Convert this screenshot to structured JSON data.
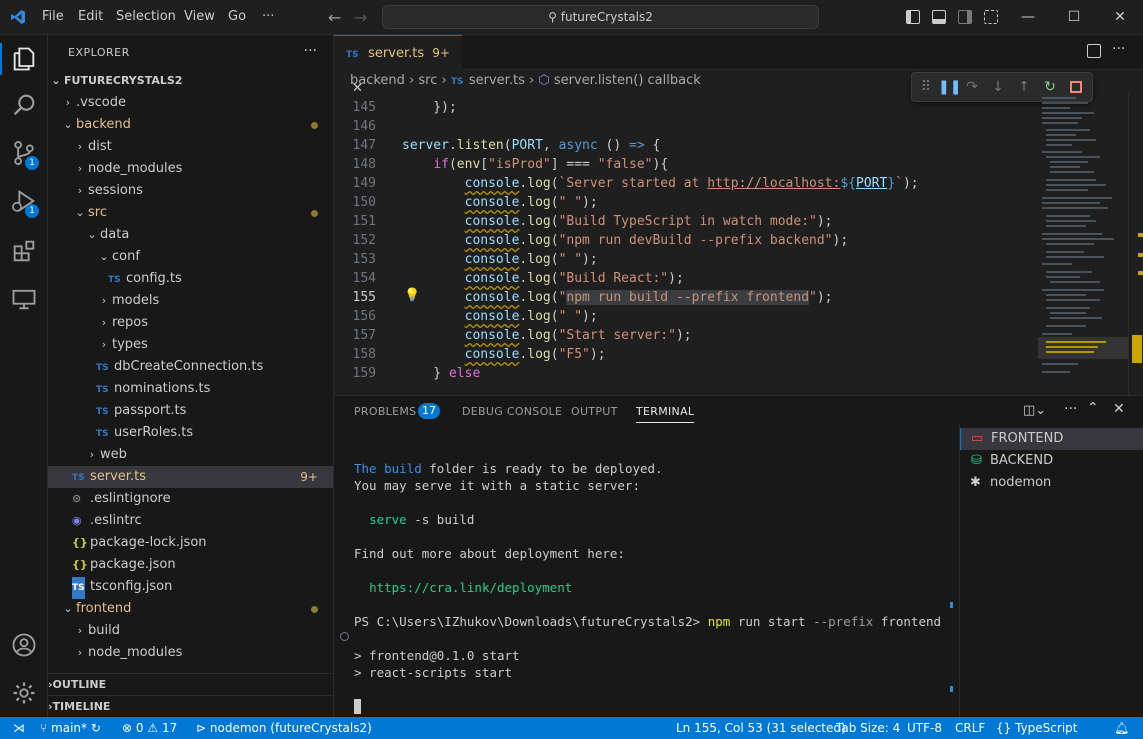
{
  "titlebar": {
    "menus": [
      "File",
      "Edit",
      "Selection",
      "View",
      "Go",
      "···"
    ],
    "search": "futureCrystals2"
  },
  "activity": {
    "scm_badge": "1",
    "debug_badge": "1"
  },
  "sidebar": {
    "header": "EXPLORER",
    "more": "···",
    "root": "FUTURECRYSTALS2",
    "items": [
      {
        "label": ".vscode",
        "indent": 1,
        "type": "folder-closed"
      },
      {
        "label": "backend",
        "indent": 1,
        "type": "folder-open",
        "modified": true,
        "color": "#e2c08d"
      },
      {
        "label": "dist",
        "indent": 2,
        "type": "folder-closed"
      },
      {
        "label": "node_modules",
        "indent": 2,
        "type": "folder-closed"
      },
      {
        "label": "sessions",
        "indent": 2,
        "type": "folder-closed"
      },
      {
        "label": "src",
        "indent": 2,
        "type": "folder-open",
        "modified": true,
        "color": "#e2c08d"
      },
      {
        "label": "data",
        "indent": 3,
        "type": "folder-open"
      },
      {
        "label": "conf",
        "indent": 4,
        "type": "folder-open"
      },
      {
        "label": "config.ts",
        "indent": 5,
        "type": "ts"
      },
      {
        "label": "models",
        "indent": 4,
        "type": "folder-closed"
      },
      {
        "label": "repos",
        "indent": 4,
        "type": "folder-closed"
      },
      {
        "label": "types",
        "indent": 4,
        "type": "folder-closed"
      },
      {
        "label": "dbCreateConnection.ts",
        "indent": 4,
        "type": "ts"
      },
      {
        "label": "nominations.ts",
        "indent": 4,
        "type": "ts"
      },
      {
        "label": "passport.ts",
        "indent": 4,
        "type": "ts"
      },
      {
        "label": "userRoles.ts",
        "indent": 4,
        "type": "ts"
      },
      {
        "label": "web",
        "indent": 3,
        "type": "folder-closed"
      },
      {
        "label": "server.ts",
        "indent": 2,
        "type": "ts",
        "selected": true,
        "badge": "9+",
        "color": "#e2c08d"
      },
      {
        "label": ".eslintignore",
        "indent": 2,
        "type": "eslintignore"
      },
      {
        "label": ".eslintrc",
        "indent": 2,
        "type": "eslint"
      },
      {
        "label": "package-lock.json",
        "indent": 2,
        "type": "json"
      },
      {
        "label": "package.json",
        "indent": 2,
        "type": "json"
      },
      {
        "label": "tsconfig.json",
        "indent": 2,
        "type": "tsconfig"
      },
      {
        "label": "frontend",
        "indent": 1,
        "type": "folder-open",
        "modified": true,
        "color": "#e2c08d"
      },
      {
        "label": "build",
        "indent": 2,
        "type": "folder-closed"
      },
      {
        "label": "node_modules",
        "indent": 2,
        "type": "folder-closed"
      }
    ],
    "outline": "OUTLINE",
    "timeline": "TIMELINE"
  },
  "editor": {
    "tab_label": "server.ts",
    "tab_badge": "9+",
    "breadcrumb": [
      "backend",
      "src",
      "server.ts",
      "server.listen() callback"
    ],
    "lines": [
      {
        "n": "145",
        "html": "    });"
      },
      {
        "n": "146",
        "html": ""
      },
      {
        "n": "147",
        "html": "<span class='v'>server</span>.<span class='f'>listen</span>(<span class='v'>PORT</span>, <span class='k'>async</span> () <span class='k'>=&gt;</span> {"
      },
      {
        "n": "148",
        "html": "    <span class='p'>if</span>(<span class='f'>env</span>[<span class='s'>\"isProd\"</span>] === <span class='s'>\"false\"</span>){"
      },
      {
        "n": "149",
        "html": "        <span class='v wavy'>console</span>.<span class='f'>log</span>(<span class='s'>`Server started at <span class='u'>http://localhost:</span></span><span class='k'>${</span><span class='v u'>PORT</span><span class='k'>}</span><span class='s'>`</span>);"
      },
      {
        "n": "150",
        "html": "        <span class='v wavy'>console</span>.<span class='f'>log</span>(<span class='s'>\" \"</span>);"
      },
      {
        "n": "151",
        "html": "        <span class='v wavy'>console</span>.<span class='f'>log</span>(<span class='s'>\"Build TypeScript in watch mode:\"</span>);"
      },
      {
        "n": "152",
        "html": "        <span class='v wavy'>console</span>.<span class='f'>log</span>(<span class='s'>\"npm run devBuild --prefix backend\"</span>);"
      },
      {
        "n": "153",
        "html": "        <span class='v wavy'>console</span>.<span class='f'>log</span>(<span class='s'>\" \"</span>);"
      },
      {
        "n": "154",
        "html": "        <span class='v wavy'>console</span>.<span class='f'>log</span>(<span class='s'>\"Build React:\"</span>);"
      },
      {
        "n": "155",
        "html": "        <span class='v wavy'>console</span>.<span class='f'>log</span>(<span class='s'>\"<span style='background:#3a3d41'>npm run build --prefix frontend</span>\"</span>);",
        "current": true
      },
      {
        "n": "156",
        "html": "        <span class='v wavy'>console</span>.<span class='f'>log</span>(<span class='s'>\" \"</span>);"
      },
      {
        "n": "157",
        "html": "        <span class='v wavy'>console</span>.<span class='f'>log</span>(<span class='s'>\"Start server:\"</span>);"
      },
      {
        "n": "158",
        "html": "        <span class='v wavy'>console</span>.<span class='f'>log</span>(<span class='s'>\"F5\"</span>);"
      },
      {
        "n": "159",
        "html": "    } <span class='p'>else</span>"
      }
    ]
  },
  "panel": {
    "tabs": [
      "PROBLEMS",
      "DEBUG CONSOLE",
      "OUTPUT",
      "TERMINAL"
    ],
    "problems_count": "17",
    "terminal_lines": [
      {
        "html": "<span class='t-blue'>The </span><span class='t-blue'>build</span> folder is ready to be deployed."
      },
      {
        "html": "You may serve it with a static server:"
      },
      {
        "html": ""
      },
      {
        "html": "  <span class='t-cyan'>serve</span> -s build"
      },
      {
        "html": ""
      },
      {
        "html": "Find out more about deployment here:"
      },
      {
        "html": ""
      },
      {
        "html": "  <span class='t-cyan'>https://cra.link/deployment</span>"
      },
      {
        "html": ""
      },
      {
        "html": "PS C:\\Users\\IZhukov\\Downloads\\futureCrystals2&gt; <span class='t-yellow'>npm</span> run start <span class='t-grey'>--prefix</span> frontend"
      },
      {
        "html": ""
      },
      {
        "html": "&gt; frontend@0.1.0 start"
      },
      {
        "html": "&gt; react-scripts start"
      }
    ],
    "terminals": [
      "FRONTEND",
      "BACKEND",
      "nodemon"
    ]
  },
  "status": {
    "branch": "main*",
    "errors": "0",
    "warnings": "17",
    "debug": "nodemon (futureCrystals2)",
    "position": "Ln 155, Col 53 (31 selected)",
    "tab_size": "Tab Size: 4",
    "encoding": "UTF-8",
    "eol": "CRLF",
    "language": "TypeScript"
  },
  "colors": {
    "accent": "#0078d4",
    "modified": "#e2c08d"
  }
}
